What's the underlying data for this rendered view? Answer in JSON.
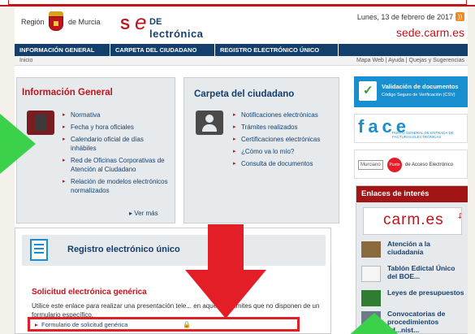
{
  "header": {
    "logo_region": "Región",
    "logo_murcia": "de Murcia",
    "sede_de": "DE",
    "sede_electronica": "lectrónica",
    "date": "Lunes, 13 de febrero de 2017",
    "sede_url": "sede.carm.es"
  },
  "navbar": {
    "items": [
      "INFORMACIÓN GENERAL",
      "CARPETA DEL CIUDADANO",
      "REGISTRO ELECTRÓNICO ÚNICO"
    ]
  },
  "breadcrumb": "Inicio",
  "util_links": "Mapa Web | Ayuda | Quejas y Sugerencias",
  "informacion_general": {
    "title": "Información General",
    "links": [
      "Normativa",
      "Fecha y hora oficiales",
      "Calendario oficial de días inhábiles",
      "Red de Oficinas Corporativas de Atención al Ciudadano",
      "Relación de modelos electrónicos normalizados"
    ],
    "ver_mas": "▸ Ver más"
  },
  "carpeta": {
    "title": "Carpeta del ciudadano",
    "links": [
      "Notificaciones electrónicas",
      "Trámites realizados",
      "Certificaciones electrónicas",
      "¿Cómo va lo mío?",
      "Consulta de documentos"
    ]
  },
  "registro": {
    "title": "Registro electrónico único",
    "solicitud_title": "Solicitud electrónica genérica",
    "solicitud_text": "Utilice este enlace para realizar una presentación tele... en aquellos trámites que no disponen de un formulario específico.",
    "formulario_link": "Formulario de solicitud genérica"
  },
  "sidebar": {
    "csv_title": "Validación de documentos",
    "csv_sub": "Código Seguro de Verificación (CSV)",
    "face_logo": "face",
    "face_sub": "PUNTO GENERAL DE ENTRADA DE FACTURAS ELECTRÓNICAS",
    "pae_murciano": "Murciano",
    "pae_punto": "Punto",
    "pae_text": "de Acceso Electrónico",
    "enlaces_title": "Enlaces de interés",
    "carm": "carm.es",
    "enlaces": [
      "Atención a la ciudadanía",
      "Tablón Edictal Único del BOE...",
      "Leyes de presupuestos",
      "Convocatorias de procedimientos ad...nist..."
    ]
  },
  "colors": {
    "brand_red": "#c0141c",
    "nav_blue": "#143e6c",
    "highlight_red": "#e41e26",
    "arrow_green": "#3cd14a"
  }
}
